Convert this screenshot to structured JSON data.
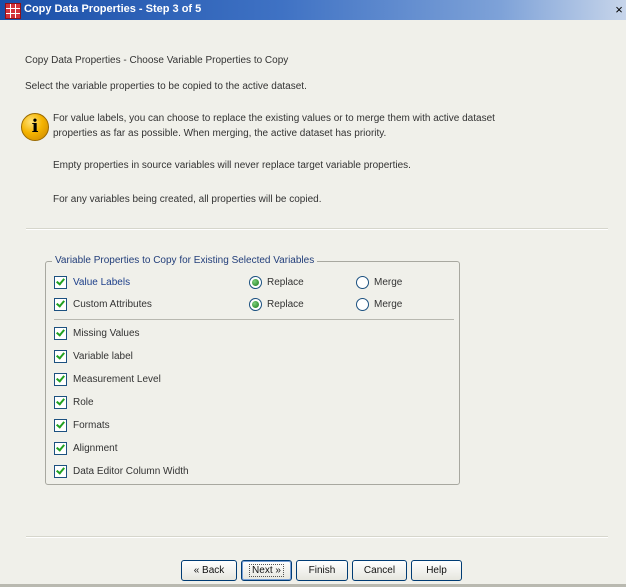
{
  "window": {
    "title": "Copy Data Properties - Step 3 of 5",
    "close_glyph": "×"
  },
  "header": {
    "subtitle": "Copy Data Properties - Choose Variable Properties to Copy",
    "instruction": "Select the variable properties to be copied to the active dataset."
  },
  "info": {
    "icon": "info-icon",
    "icon_glyph": "i",
    "line1": "For value labels, you can choose to replace the existing values or to merge them with active dataset",
    "line2": "properties as far as possible. When merging, the active dataset has priority.",
    "empty_note": "Empty properties in source variables will never replace target variable properties.",
    "new_note": "For any variables being created, all properties will be copied."
  },
  "group": {
    "title": "Variable Properties to Copy for Existing Selected Variables",
    "labels_options": [
      {
        "label": "Value Labels",
        "checked": true,
        "replace": "Replace",
        "merge": "Merge",
        "selected": "Replace"
      },
      {
        "label": "Custom Attributes",
        "checked": true,
        "replace": "Replace",
        "merge": "Merge",
        "selected": "Replace"
      }
    ],
    "properties": [
      {
        "label": "Missing Values",
        "checked": true
      },
      {
        "label": "Variable label",
        "checked": true
      },
      {
        "label": "Measurement Level",
        "checked": true
      },
      {
        "label": "Role",
        "checked": true
      },
      {
        "label": "Formats",
        "checked": true
      },
      {
        "label": "Alignment",
        "checked": true
      },
      {
        "label": "Data Editor Column Width",
        "checked": true
      }
    ]
  },
  "buttons": {
    "back": "« Back",
    "next": "Next »",
    "finish": "Finish",
    "cancel": "Cancel",
    "help": "Help"
  },
  "colors": {
    "title_bar": "#1a4fa8",
    "dialog_bg": "#f0f0ea",
    "check_green": "#21a121",
    "button_border": "#003c74"
  }
}
